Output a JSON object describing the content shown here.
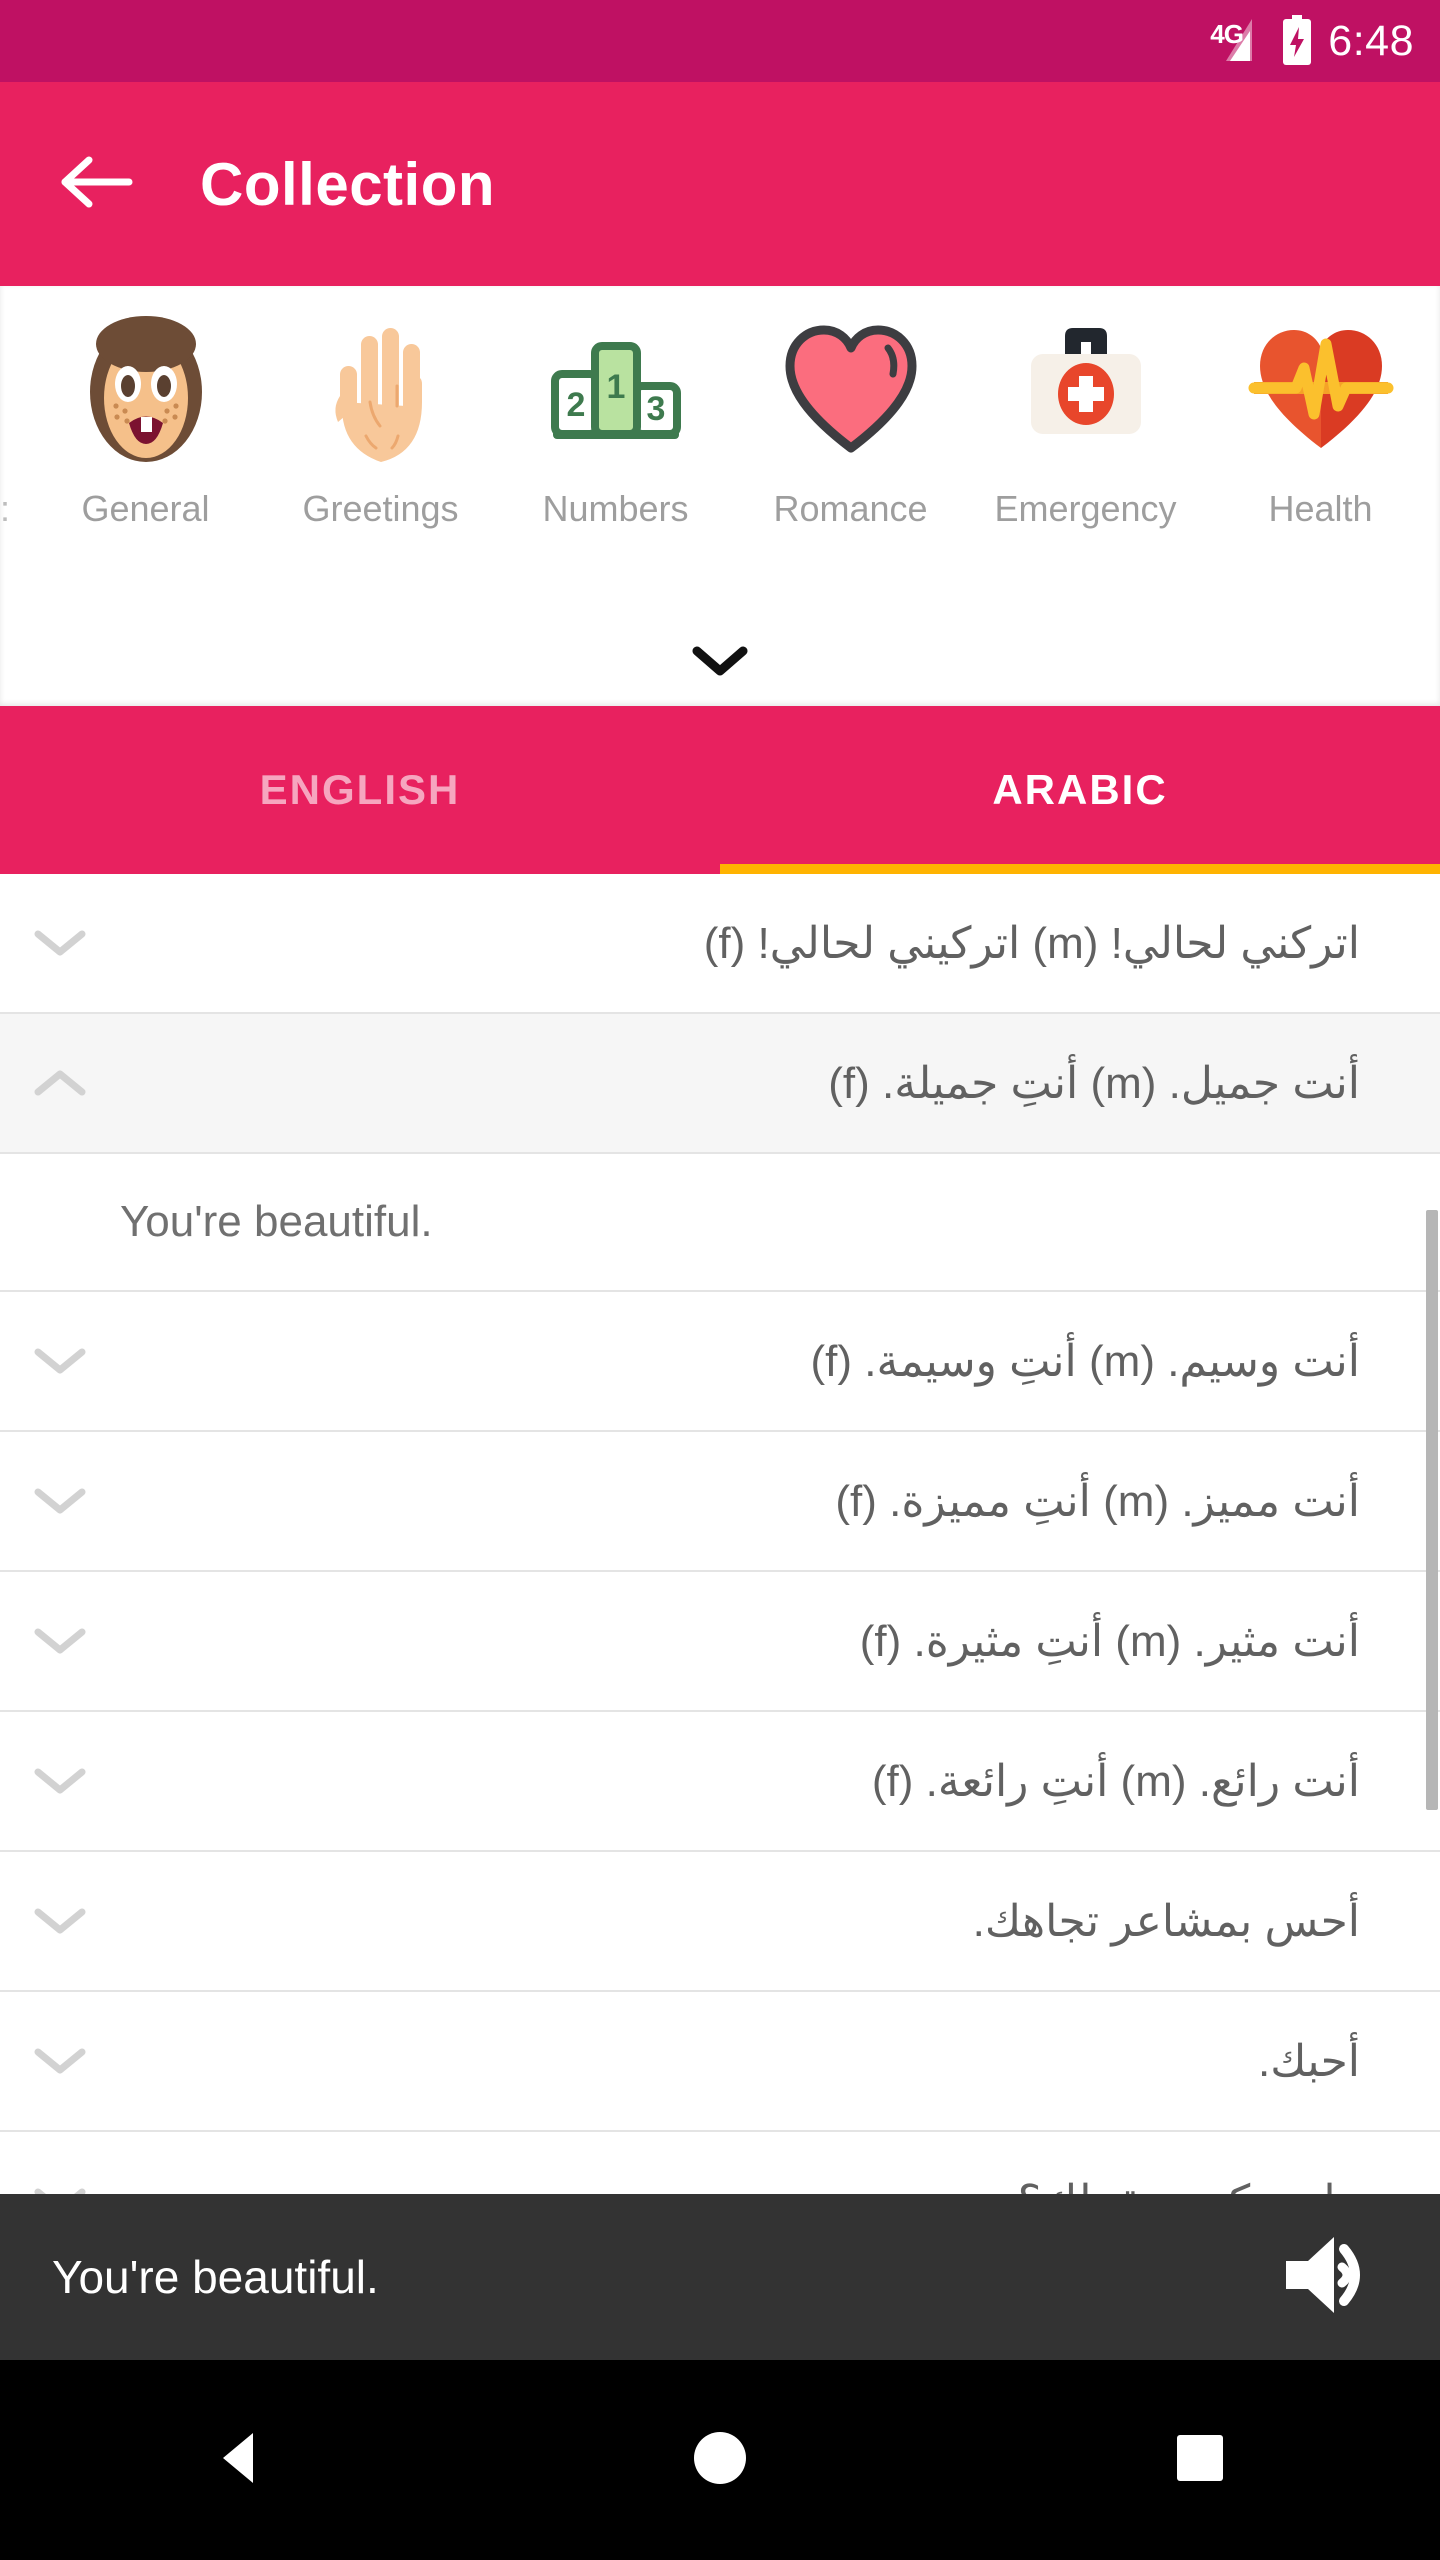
{
  "statusbar": {
    "network": "4G",
    "time": "6:48",
    "signal_icon": "signal-bars-icon",
    "battery_icon": "battery-charging-icon"
  },
  "appbar": {
    "back_icon": "back-arrow-icon",
    "title": "Collection",
    "background": "#E8215F"
  },
  "categories": {
    "expander_icon": "chevron-down-icon",
    "items": [
      {
        "label": ":",
        "icon": "clipped-label",
        "clipped": true
      },
      {
        "label": "General",
        "icon": "girl-face-icon"
      },
      {
        "label": "Greetings",
        "icon": "raised-hand-icon"
      },
      {
        "label": "Numbers",
        "icon": "podium-123-icon"
      },
      {
        "label": "Romance",
        "icon": "pink-heart-icon"
      },
      {
        "label": "Emergency",
        "icon": "first-aid-kit-icon"
      },
      {
        "label": "Health",
        "icon": "heartbeat-icon"
      }
    ]
  },
  "tabs": {
    "items": [
      {
        "label": "ENGLISH",
        "active": false
      },
      {
        "label": "ARABIC",
        "active": true
      }
    ],
    "indicator_color": "#FFB300"
  },
  "list": {
    "rows": [
      {
        "text": "اتركني لحالي! (m)  اتركيني لحالي! (f)",
        "state": "collapsed",
        "chevron": "chevron-down-icon"
      },
      {
        "text": "أنت جميل. (m)  أنتِ جميلة. (f)",
        "state": "expanded",
        "chevron": "chevron-up-icon"
      },
      {
        "text": "You're beautiful.",
        "state": "translation"
      },
      {
        "text": "أنت وسيم. (m)  أنتِ وسيمة. (f)",
        "state": "collapsed",
        "chevron": "chevron-down-icon"
      },
      {
        "text": "أنت مميز. (m)  أنتِ مميزة. (f)",
        "state": "collapsed",
        "chevron": "chevron-down-icon"
      },
      {
        "text": "أنت مثير. (m)  أنتِ مثيرة. (f)",
        "state": "collapsed",
        "chevron": "chevron-down-icon"
      },
      {
        "text": "أنت رائع. (m)  أنتِ رائعة. (f)",
        "state": "collapsed",
        "chevron": "chevron-down-icon"
      },
      {
        "text": "أحس بمشاعر تجاهك.",
        "state": "collapsed",
        "chevron": "chevron-down-icon"
      },
      {
        "text": "أحبك.",
        "state": "collapsed",
        "chevron": "chevron-down-icon"
      },
      {
        "text": "هل يمكنني تقبيلك؟",
        "state": "collapsed",
        "chevron": "chevron-down-icon"
      }
    ]
  },
  "player": {
    "text": "You're beautiful.",
    "speaker_icon": "volume-speaker-icon",
    "background": "#333333"
  },
  "navbar": {
    "back_icon": "nav-back-triangle-icon",
    "home_icon": "nav-home-circle-icon",
    "recents_icon": "nav-recents-square-icon"
  }
}
